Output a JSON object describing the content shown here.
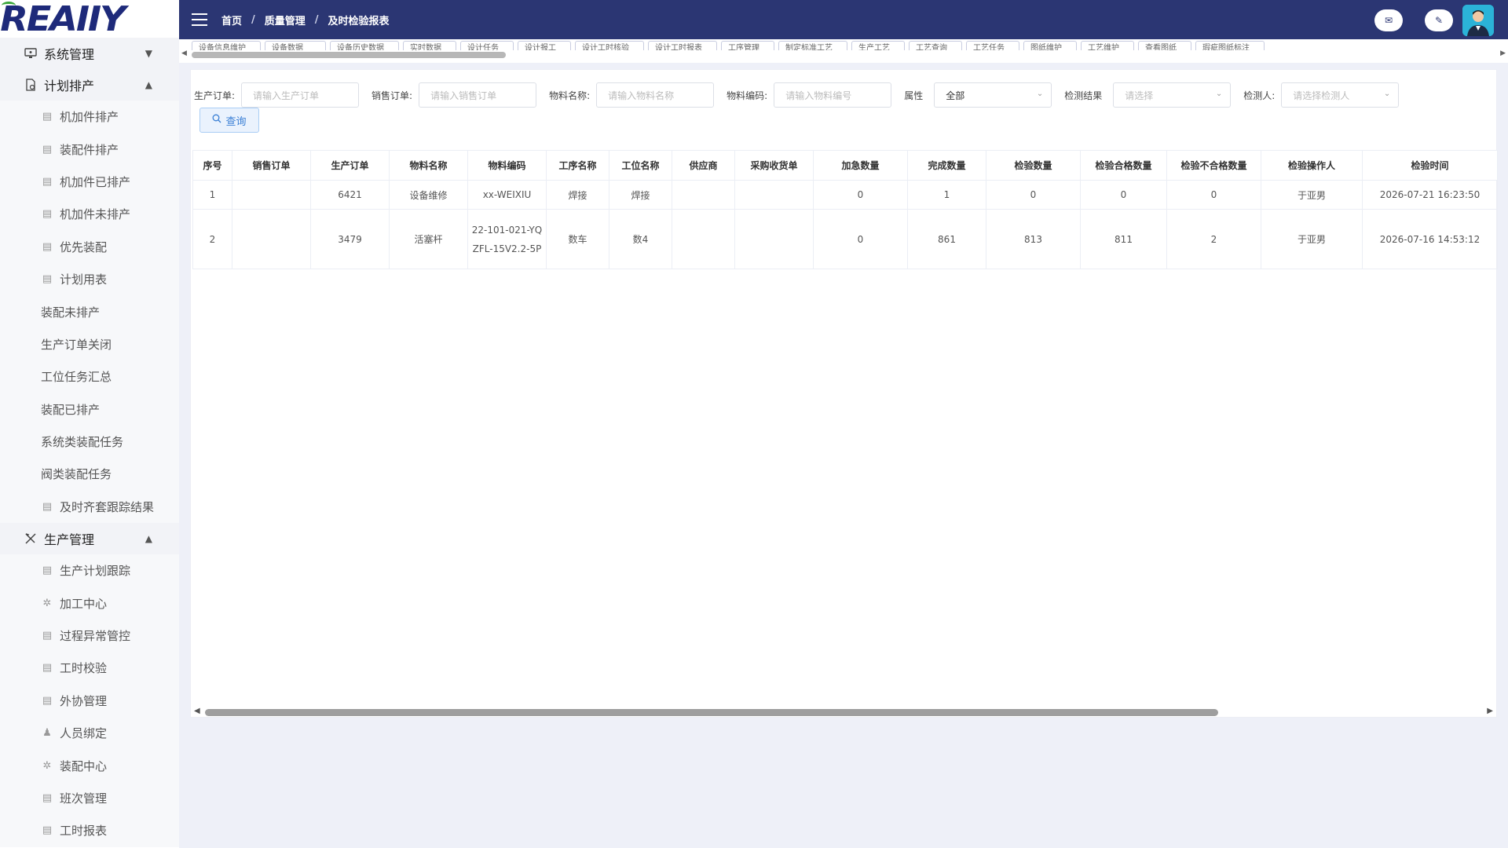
{
  "logo": {
    "text": "REAIIY"
  },
  "sidebar": {
    "groups": [
      {
        "label": "系统管理",
        "icon": "monitor-icon",
        "expanded": false
      },
      {
        "label": "计划排产",
        "icon": "document-icon",
        "expanded": true,
        "items": [
          "机加件排产",
          "装配件排产",
          "机加件已排产",
          "机加件未排产",
          "优先装配",
          "计划用表",
          "装配未排产",
          "生产订单关闭",
          "工位任务汇总",
          "装配已排产",
          "系统类装配任务",
          "阀类装配任务",
          "及时齐套跟踪结果"
        ]
      },
      {
        "label": "生产管理",
        "icon": "tools-icon",
        "expanded": true,
        "items": [
          "生产计划跟踪",
          "加工中心",
          "过程异常管控",
          "工时校验",
          "外协管理",
          "人员绑定",
          "装配中心",
          "班次管理",
          "工时报表"
        ]
      }
    ]
  },
  "header": {
    "breadcrumb": [
      "首页",
      "质量管理",
      "及时检验报表"
    ],
    "separator": "/"
  },
  "tags": [
    "设备信息维护",
    "设备数据",
    "设备历史数据",
    "实时数据",
    "设计任务",
    "设计报工",
    "设计工时核验",
    "设计工时报表",
    "工序管理",
    "制定标准工艺",
    "生产工艺",
    "工艺查询",
    "工艺任务",
    "图纸维护",
    "工艺维护",
    "查看图纸",
    "瑕疵图纸标注"
  ],
  "filters": [
    {
      "label": "生产订单:",
      "placeholder": "请输入生产订单"
    },
    {
      "label": "销售订单:",
      "placeholder": "请输入销售订单"
    },
    {
      "label": "物料名称:",
      "placeholder": "请输入物料名称"
    },
    {
      "label": "物料编码:",
      "placeholder": "请输入物料编号"
    },
    {
      "label": "属性",
      "value": "全部"
    },
    {
      "label": "检测结果",
      "placeholder": "请选择"
    },
    {
      "label": "检测人:",
      "placeholder": "请选择检测人"
    }
  ],
  "query_button": "查询",
  "table": {
    "columns": [
      "序号",
      "销售订单",
      "生产订单",
      "物料名称",
      "物料编码",
      "工序名称",
      "工位名称",
      "供应商",
      "采购收货单",
      "加急数量",
      "完成数量",
      "检验数量",
      "检验合格数量",
      "检验不合格数量",
      "检验操作人",
      "检验时间"
    ],
    "rows": [
      [
        "1",
        "",
        "6421",
        "设备维修",
        "xx-WEIXIU",
        "焊接",
        "焊接",
        "",
        "",
        "0",
        "1",
        "0",
        "0",
        "0",
        "于亚男",
        "2026-07-21 16:23:50"
      ],
      [
        "2",
        "",
        "3479",
        "活塞杆",
        "22-101-021-YQZFL-15V2.2-5P",
        "数车",
        "数4",
        "",
        "",
        "0",
        "861",
        "813",
        "811",
        "2",
        "于亚男",
        "2026-07-16 14:53:12"
      ]
    ]
  },
  "colors": {
    "header_bg": "#2b3673",
    "accent": "#3a7fd5"
  }
}
